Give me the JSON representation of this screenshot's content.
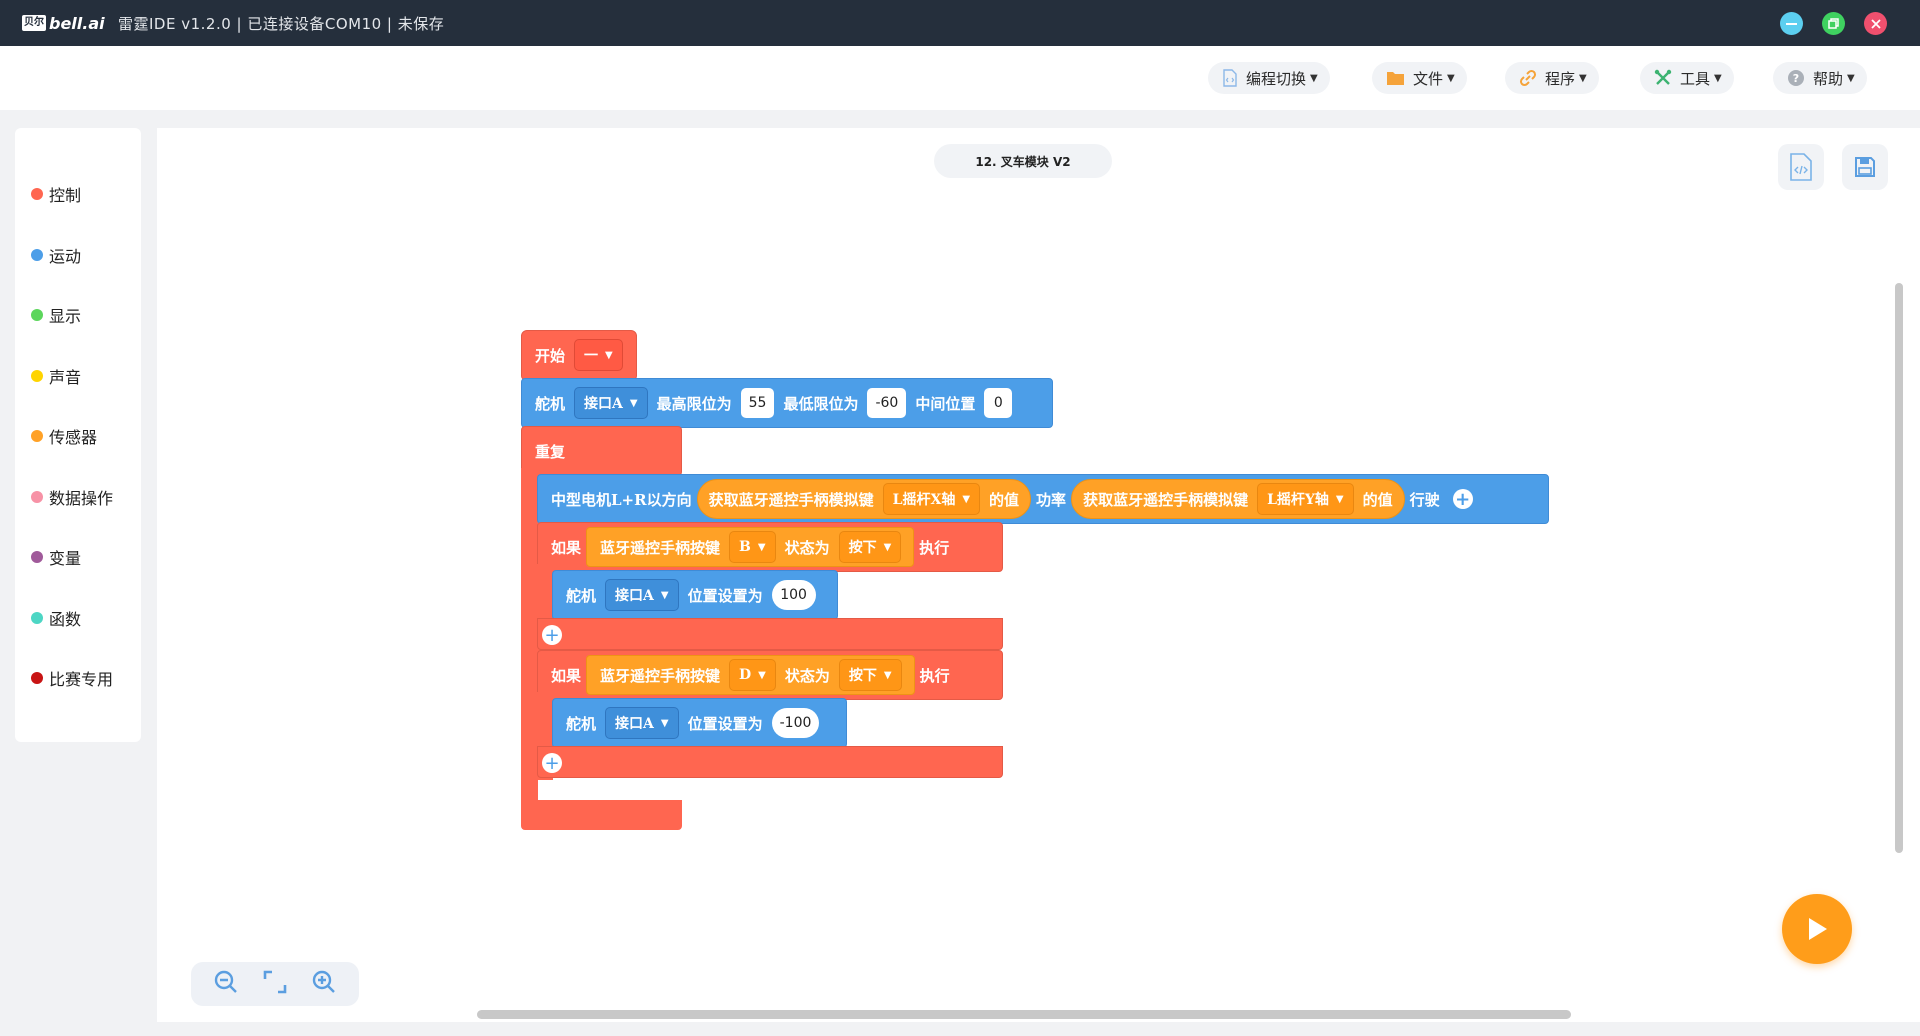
{
  "titlebar": {
    "logo_cn": "贝尔",
    "logo_en": "bell.ai",
    "title": "雷霆IDE v1.2.0 | 已连接设备COM10 | 未保存",
    "minimize_color": "#5ccff0",
    "maximize_color": "#3fd160",
    "close_color": "#f0506e"
  },
  "menu": {
    "items": [
      {
        "label": "编程切换",
        "icon": "code-switch-icon"
      },
      {
        "label": "文件",
        "icon": "folder-icon"
      },
      {
        "label": "程序",
        "icon": "link-icon"
      },
      {
        "label": "工具",
        "icon": "tools-icon"
      },
      {
        "label": "帮助",
        "icon": "help-icon"
      }
    ]
  },
  "sidebar": {
    "categories": [
      {
        "label": "控制",
        "color": "#ff6650"
      },
      {
        "label": "运动",
        "color": "#4c9ee8"
      },
      {
        "label": "显示",
        "color": "#5cd65c"
      },
      {
        "label": "声音",
        "color": "#ffd400"
      },
      {
        "label": "传感器",
        "color": "#ffa126"
      },
      {
        "label": "数据操作",
        "color": "#f792a6"
      },
      {
        "label": "变量",
        "color": "#a05a9a"
      },
      {
        "label": "函数",
        "color": "#4dd6c4"
      },
      {
        "label": "比赛专用",
        "color": "#c81414"
      }
    ]
  },
  "workspace": {
    "file_name": "12. 叉车模块 V2",
    "blocks": {
      "start": {
        "label": "开始",
        "dropdown": "一"
      },
      "servo_limits": {
        "label": "舵机",
        "port": "接口A",
        "max_label": "最高限位为",
        "max_value": "55",
        "min_label": "最低限位为",
        "min_value": "-60",
        "mid_label": "中间位置",
        "mid_value": "0"
      },
      "repeat": {
        "label": "重复"
      },
      "motor": {
        "label": "中型电机L+R以方向",
        "dir_sensor": "获取蓝牙遥控手柄模拟键",
        "dir_axis": "L摇杆X轴",
        "dir_suffix": "的值",
        "power_label": "功率",
        "power_sensor": "获取蓝牙遥控手柄模拟键",
        "power_axis": "L摇杆Y轴",
        "power_suffix": "的值",
        "run_label": "行驶"
      },
      "if1": {
        "if_label": "如果",
        "cond": "蓝牙遥控手柄按键",
        "key": "B",
        "state_label": "状态为",
        "state": "按下",
        "do_label": "执行",
        "servo_label": "舵机",
        "servo_port": "接口A",
        "set_label": "位置设置为",
        "set_value": "100"
      },
      "if2": {
        "if_label": "如果",
        "cond": "蓝牙遥控手柄按键",
        "key": "D",
        "state_label": "状态为",
        "state": "按下",
        "do_label": "执行",
        "servo_label": "舵机",
        "servo_port": "接口A",
        "set_label": "位置设置为",
        "set_value": "-100"
      }
    }
  }
}
